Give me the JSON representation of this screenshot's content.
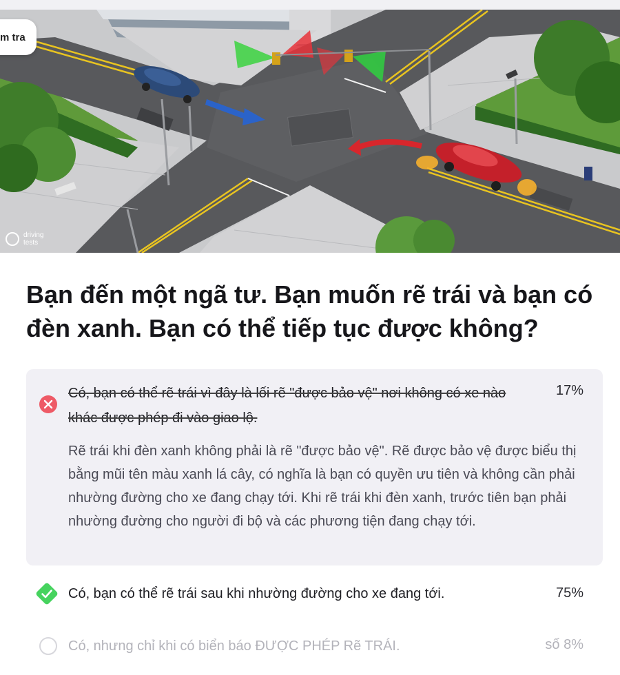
{
  "header": {
    "tag_label": "m tra"
  },
  "illustration": {
    "watermark_line1": "driving",
    "watermark_line2": "tests"
  },
  "question": {
    "text": "Bạn đến một ngã tư. Bạn muốn rẽ trái và bạn có đèn xanh. Bạn có thể tiếp tục được không?"
  },
  "answers": [
    {
      "state": "incorrect",
      "text": "Có, bạn có thể rẽ trái vì đây là lối rẽ \"được bảo vệ\" nơi không có xe nào khác được phép đi vào giao lộ.",
      "percent": "17%",
      "explanation": "Rẽ trái khi đèn xanh không phải là rẽ \"được bảo vệ\". Rẽ được bảo vệ được biểu thị bằng mũi tên màu xanh lá cây, có nghĩa là bạn có quyền ưu tiên và không cần phải nhường đường cho xe đang chạy tới. Khi rẽ trái khi đèn xanh, trước tiên bạn phải nhường đường cho người đi bộ và các phương tiện đang chạy tới."
    },
    {
      "state": "correct",
      "text": "Có, bạn có thể rẽ trái sau khi nhường đường cho xe đang tới.",
      "percent": "75%"
    },
    {
      "state": "neutral",
      "text": "Có, nhưng chỉ khi có biển báo ĐƯỢC PHÉP Rẽ TRÁI.",
      "percent": "số 8%"
    }
  ],
  "colors": {
    "incorrect": "#ee5a66",
    "correct": "#46d35e",
    "selected_bg": "#f1f0f5",
    "faded_text": "#b3b3ba"
  }
}
